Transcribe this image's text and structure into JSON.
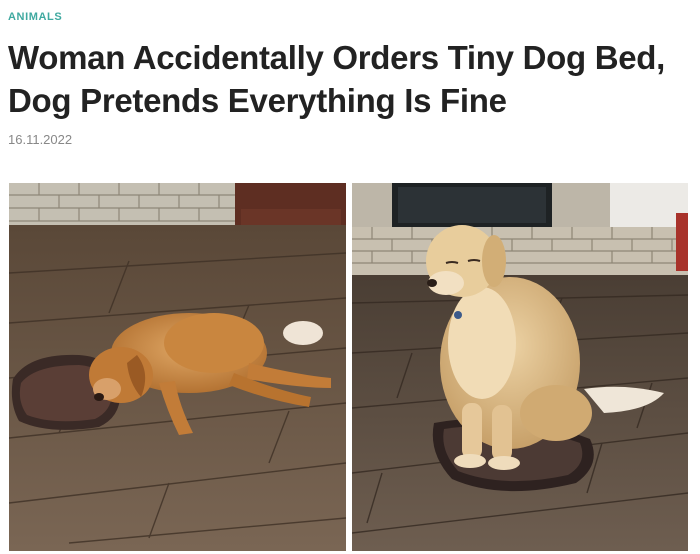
{
  "article": {
    "category": "ANIMALS",
    "title": "Woman Accidentally Orders Tiny Dog Bed, Dog Pretends Everything Is Fine",
    "date": "16.11.2022"
  },
  "photos": [
    {
      "name": "dog-lying-beside-tiny-bed-photo"
    },
    {
      "name": "dog-sitting-on-tiny-bed-photo"
    }
  ],
  "colors": {
    "category": "#3fa9a0",
    "title": "#222222",
    "date": "#888888"
  }
}
